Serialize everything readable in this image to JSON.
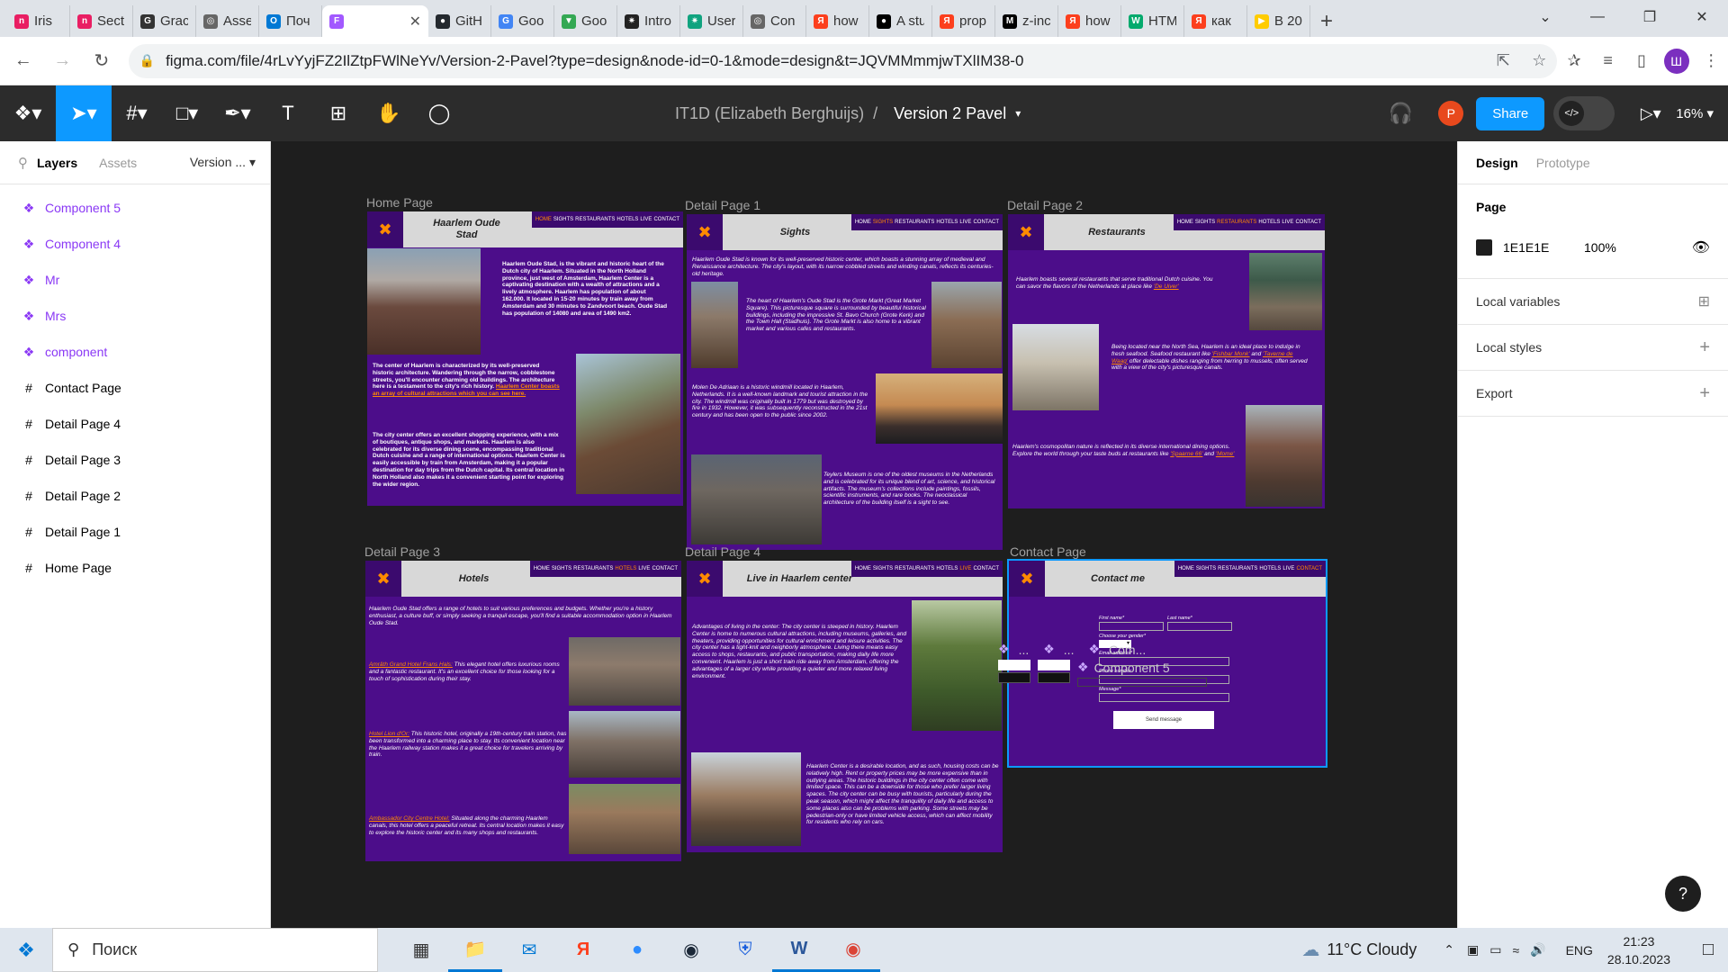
{
  "browser": {
    "tabs": [
      {
        "label": "Iris",
        "icon": "ngh-favicon",
        "color": "#e91e63",
        "glyph": "n"
      },
      {
        "label": "Sect",
        "icon": "ngh-favicon",
        "color": "#e91e63",
        "glyph": "n"
      },
      {
        "label": "Grac",
        "icon": "gw-favicon",
        "color": "#333333",
        "glyph": "G"
      },
      {
        "label": "Asse",
        "icon": "globe-favicon",
        "color": "#666666",
        "glyph": "◎"
      },
      {
        "label": "Поч",
        "icon": "outlook-favicon",
        "color": "#0078d4",
        "glyph": "O"
      },
      {
        "label": "",
        "icon": "figma-favicon",
        "color": "#a259ff",
        "glyph": "F",
        "active": true
      },
      {
        "label": "GitH",
        "icon": "github-favicon",
        "color": "#24292e",
        "glyph": "●"
      },
      {
        "label": "Goo",
        "icon": "google-translate-favicon",
        "color": "#4285f4",
        "glyph": "G"
      },
      {
        "label": "Goo",
        "icon": "google-maps-favicon",
        "color": "#34a853",
        "glyph": "▼"
      },
      {
        "label": "Intro",
        "icon": "openai-favicon",
        "color": "#222222",
        "glyph": "✷"
      },
      {
        "label": "User",
        "icon": "chatgpt-favicon",
        "color": "#10a37f",
        "glyph": "✷"
      },
      {
        "label": "Con",
        "icon": "globe-favicon",
        "color": "#666666",
        "glyph": "◎"
      },
      {
        "label": "how",
        "icon": "yandex-favicon",
        "color": "#fc3f1d",
        "glyph": "Я"
      },
      {
        "label": "A stu",
        "icon": "medium-favicon",
        "color": "#000000",
        "glyph": "●"
      },
      {
        "label": "prop",
        "icon": "yandex-favicon",
        "color": "#fc3f1d",
        "glyph": "Я"
      },
      {
        "label": "z-inc",
        "icon": "mdn-favicon",
        "color": "#000000",
        "glyph": "M"
      },
      {
        "label": "how",
        "icon": "yandex-favicon",
        "color": "#fc3f1d",
        "glyph": "Я"
      },
      {
        "label": "HTM",
        "icon": "w3schools-favicon",
        "color": "#04aa6d",
        "glyph": "W"
      },
      {
        "label": "как",
        "icon": "yandex-favicon",
        "color": "#fc3f1d",
        "glyph": "Я"
      },
      {
        "label": "В 20",
        "icon": "play-favicon",
        "color": "#ffcc00",
        "glyph": "▶"
      }
    ],
    "url": "figma.com/file/4rLvYyjFZ2IlZtpFWlNeYv/Version-2-Pavel?type=design&node-id=0-1&mode=design&t=JQVMMmmjwTXlIM38-0",
    "profile_initial": "Ш"
  },
  "figma": {
    "file_project": "IT1D (Elizabeth Berghuijs)",
    "separator": "/",
    "file_version": "Version 2 Pavel",
    "share_label": "Share",
    "avatar_initial": "P",
    "zoom": "16%",
    "left_tabs": {
      "layers": "Layers",
      "assets": "Assets",
      "version": "Version ..."
    },
    "layers": [
      {
        "name": "Component 5",
        "type": "component"
      },
      {
        "name": "Component 4",
        "type": "component"
      },
      {
        "name": "Mr",
        "type": "component"
      },
      {
        "name": "Mrs",
        "type": "component"
      },
      {
        "name": "component",
        "type": "component"
      },
      {
        "name": "Contact Page",
        "type": "frame"
      },
      {
        "name": "Detail Page 4",
        "type": "frame"
      },
      {
        "name": "Detail Page 3",
        "type": "frame"
      },
      {
        "name": "Detail Page 2",
        "type": "frame"
      },
      {
        "name": "Detail Page 1",
        "type": "frame"
      },
      {
        "name": "Home Page",
        "type": "frame"
      }
    ],
    "right": {
      "tabs": {
        "design": "Design",
        "prototype": "Prototype"
      },
      "page_label": "Page",
      "page_color": "1E1E1E",
      "page_opacity": "100%",
      "local_variables": "Local variables",
      "local_styles": "Local styles",
      "export": "Export",
      "help": "?"
    }
  },
  "site": {
    "nav": [
      "HOME",
      "SIGHTS",
      "RESTAURANTS",
      "HOTELS",
      "LIVE",
      "CONTACT"
    ],
    "logo": "✖",
    "frames": {
      "home": {
        "label": "Home Page",
        "title": "Haarlem Oude Stad",
        "p1": "Haarlem Oude Stad, is the vibrant and historic heart of the Dutch city of Haarlem. Situated in the North Holland province, just west of Amsterdam, Haarlem Center is a captivating destination with a wealth of attractions and a lively atmosphere. Haarlem has population of about 162.000. It located in 15-20 minutes by train away from Amsterdam and 30 minutes to Zandvoort beach. Oude Stad has population of 14080 and area of 1490 km2.",
        "p2": "The center of Haarlem is characterized by its well-preserved historic architecture. Wandering through the narrow, cobblestone streets, you'll encounter charming old buildings. The architecture here is a testament to the city's rich history.",
        "p2_link": "Haarlem Center boasts an array of cultural attractions which you can see here.",
        "p3": "The city center offers an excellent shopping experience, with a mix of boutiques, antique shops, and markets. Haarlem is also celebrated for its diverse dining scene, encompassing traditional Dutch cuisine and a range of international options. Haarlem Center is easily accessible by train from Amsterdam, making it a popular destination for day trips from the Dutch capital. Its central location in North Holland also makes it a convenient starting point for exploring the wider region."
      },
      "sights": {
        "label": "Detail Page 1",
        "title": "Sights",
        "p1": "Haarlem Oude Stad is known for its well-preserved historic center, which boasts a stunning array of medieval and Renaissance architecture. The city's layout, with its narrow cobbled streets and winding canals, reflects its centuries-old heritage.",
        "p2": "The heart of Haarlem's Oude Stad is the Grote Markt (Great Market Square). This picturesque square is surrounded by beautiful historical buildings, including the impressive St. Bavo Church (Grote Kerk) and the Town Hall (Stadhuis). The Grote Markt is also home to a vibrant market and various cafes and restaurants.",
        "p3": "Molen De Adriaan is a historic windmill located in Haarlem, Netherlands. It is a well-known landmark and tourist attraction in the city. The windmill was originally built in 1779 but was destroyed by fire in 1932. However, it was subsequently reconstructed in the 21st century and has been open to the public since 2002.",
        "p4": "Teylers Museum is one of the oldest museums in the Netherlands and is celebrated for its unique blend of art, science, and historical artifacts. The museum's collections include paintings, fossils, scientific instruments, and rare books. The neoclassical architecture of the building itself is a sight to see."
      },
      "restaurants": {
        "label": "Detail Page 2",
        "title": "Restaurants",
        "p1": "Haarlem boasts several restaurants that serve traditional Dutch cuisine. You can savor the flavors of the Netherlands at place like",
        "p1_link": "'De Uiver'",
        "p2_a": "Being located near the North Sea, Haarlem is an ideal place to indulge in fresh seafood. Seafood restaurant like",
        "p2_link1": "'Fishbar Monk'",
        "p2_and": "and",
        "p2_link2": "'Taverne de Waag'",
        "p2_b": "offer delectable dishes ranging from herring to mussels, often served with a view of the city's picturesque canals.",
        "p3_a": "Haarlem's cosmopolitan nature is reflected in its diverse international dining options. Explore the world through your taste buds at restaurants like",
        "p3_link1": "'Spaarne 66'",
        "p3_and": "and",
        "p3_link2": "'Mome'"
      },
      "hotels": {
        "label": "Detail Page 3",
        "title": "Hotels",
        "p1": "Haarlem Oude Stad offers a range of hotels to suit various preferences and budgets. Whether you're a history enthusiast, a culture buff, or simply seeking a tranquil escape, you'll find a suitable accommodation option in Haarlem Oude Stad.",
        "h1": "Amrâth Grand Hotel Frans Hals:",
        "p2": "This elegant hotel offers luxurious rooms and a fantastic restaurant. It's an excellent choice for those looking for a touch of sophistication during their stay.",
        "h2": "Hotel Lion d'Or:",
        "p3": "This historic hotel, originally a 19th-century train station, has been transformed into a charming place to stay. Its convenient location near the Haarlem railway station makes it a great choice for travelers arriving by train.",
        "h3": "Ambassador City Centre Hotel:",
        "p4": "Situated along the charming Haarlem canals, this hotel offers a peaceful retreat. Its central location makes it easy to explore the historic center and its many shops and restaurants."
      },
      "live": {
        "label": "Detail Page 4",
        "title": "Live in Haarlem center",
        "p1": "Advantages of living in the center: The city center is steeped in history. Haarlem Center is home to numerous cultural attractions, including museums, galleries, and theaters, providing opportunities for cultural enrichment and leisure activities. The city center has a tight-knit and neighborly atmosphere. Living there means easy access to shops, restaurants, and public transportation, making daily life more convenient. Haarlem is just a short train ride away from Amsterdam, offering the advantages of a larger city while providing a quieter and more relaxed living environment.",
        "p2": "Haarlem Center is a desirable location, and as such, housing costs can be relatively high. Rent or property prices may be more expensive than in outlying areas. The historic buildings in the city center often come with limited space. This can be a downside for those who prefer larger living spaces. The city center can be busy with tourists, particularly during the peak season, which might affect the tranquility of daily life and access to some places also can be problems with parking. Some streets may be pedestrian-only or have limited vehicle access, which can affect mobility for residents who rely on cars."
      },
      "contact": {
        "label": "Contact Page",
        "title": "Contact me",
        "first_name": "First name*",
        "last_name": "Last name*",
        "gender": "Choose your gender*",
        "email": "Email address*",
        "phone": "Phone number",
        "message": "Message*",
        "send": "Send message"
      }
    },
    "components_label": {
      "a": "...",
      "b": "...",
      "c": "Com...",
      "d": "Component 5"
    }
  },
  "taskbar": {
    "search_placeholder": "Поиск",
    "weather": "11°C  Cloudy",
    "lang": "ENG",
    "time": "21:23",
    "date": "28.10.2023"
  }
}
